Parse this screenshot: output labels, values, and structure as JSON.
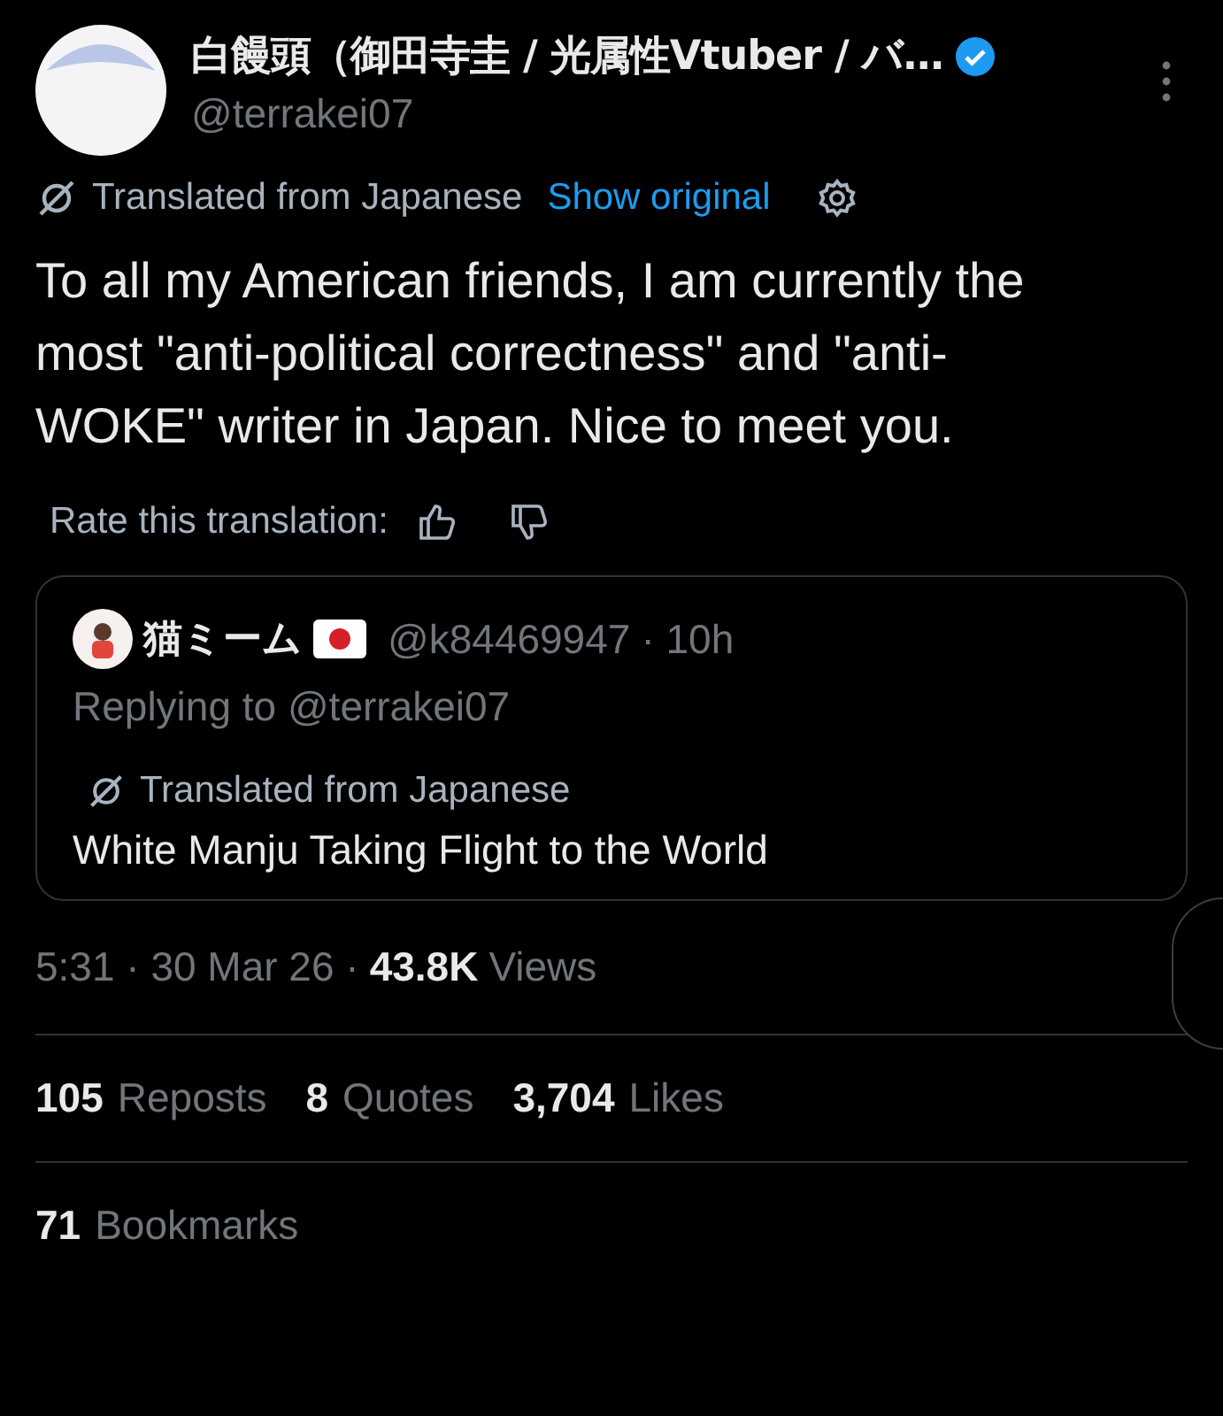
{
  "author": {
    "name": "白饅頭（御田寺圭 / 光属性Vtuber / バ…",
    "handle": "@terrakei07",
    "verified": true
  },
  "translation": {
    "label": "Translated from Japanese",
    "link": "Show original"
  },
  "text": "To all my American friends, I am currently the most \"anti-political correctness\" and \"anti-WOKE\" writer in Japan. Nice to meet you.",
  "rate": {
    "label": "Rate this translation:"
  },
  "quote": {
    "name": "猫ミーム",
    "handle": "@k84469947",
    "time": "· 10h",
    "replying": "Replying to @terrakei07",
    "translation_label": "Translated from Japanese",
    "text": "White Manju Taking Flight to the World"
  },
  "meta": {
    "time": "5:31 · 30 Mar 26 ·",
    "views_count": "43.8K",
    "views_label": "Views"
  },
  "stats": [
    {
      "count": "105",
      "label": "Reposts"
    },
    {
      "count": "8",
      "label": "Quotes"
    },
    {
      "count": "3,704",
      "label": "Likes"
    }
  ],
  "bookmarks": {
    "count": "71",
    "label": "Bookmarks"
  }
}
